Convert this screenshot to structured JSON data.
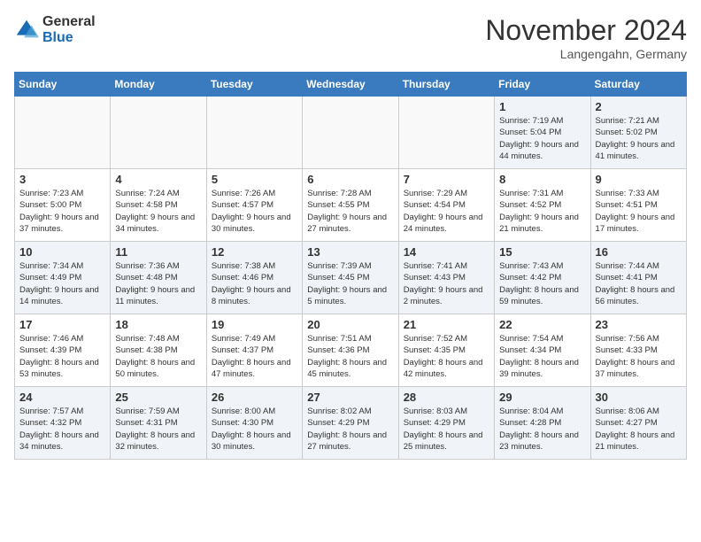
{
  "header": {
    "logo_general": "General",
    "logo_blue": "Blue",
    "month_title": "November 2024",
    "location": "Langengahn, Germany"
  },
  "weekdays": [
    "Sunday",
    "Monday",
    "Tuesday",
    "Wednesday",
    "Thursday",
    "Friday",
    "Saturday"
  ],
  "weeks": [
    [
      {
        "day": "",
        "info": ""
      },
      {
        "day": "",
        "info": ""
      },
      {
        "day": "",
        "info": ""
      },
      {
        "day": "",
        "info": ""
      },
      {
        "day": "",
        "info": ""
      },
      {
        "day": "1",
        "info": "Sunrise: 7:19 AM\nSunset: 5:04 PM\nDaylight: 9 hours\nand 44 minutes."
      },
      {
        "day": "2",
        "info": "Sunrise: 7:21 AM\nSunset: 5:02 PM\nDaylight: 9 hours\nand 41 minutes."
      }
    ],
    [
      {
        "day": "3",
        "info": "Sunrise: 7:23 AM\nSunset: 5:00 PM\nDaylight: 9 hours\nand 37 minutes."
      },
      {
        "day": "4",
        "info": "Sunrise: 7:24 AM\nSunset: 4:58 PM\nDaylight: 9 hours\nand 34 minutes."
      },
      {
        "day": "5",
        "info": "Sunrise: 7:26 AM\nSunset: 4:57 PM\nDaylight: 9 hours\nand 30 minutes."
      },
      {
        "day": "6",
        "info": "Sunrise: 7:28 AM\nSunset: 4:55 PM\nDaylight: 9 hours\nand 27 minutes."
      },
      {
        "day": "7",
        "info": "Sunrise: 7:29 AM\nSunset: 4:54 PM\nDaylight: 9 hours\nand 24 minutes."
      },
      {
        "day": "8",
        "info": "Sunrise: 7:31 AM\nSunset: 4:52 PM\nDaylight: 9 hours\nand 21 minutes."
      },
      {
        "day": "9",
        "info": "Sunrise: 7:33 AM\nSunset: 4:51 PM\nDaylight: 9 hours\nand 17 minutes."
      }
    ],
    [
      {
        "day": "10",
        "info": "Sunrise: 7:34 AM\nSunset: 4:49 PM\nDaylight: 9 hours\nand 14 minutes."
      },
      {
        "day": "11",
        "info": "Sunrise: 7:36 AM\nSunset: 4:48 PM\nDaylight: 9 hours\nand 11 minutes."
      },
      {
        "day": "12",
        "info": "Sunrise: 7:38 AM\nSunset: 4:46 PM\nDaylight: 9 hours\nand 8 minutes."
      },
      {
        "day": "13",
        "info": "Sunrise: 7:39 AM\nSunset: 4:45 PM\nDaylight: 9 hours\nand 5 minutes."
      },
      {
        "day": "14",
        "info": "Sunrise: 7:41 AM\nSunset: 4:43 PM\nDaylight: 9 hours\nand 2 minutes."
      },
      {
        "day": "15",
        "info": "Sunrise: 7:43 AM\nSunset: 4:42 PM\nDaylight: 8 hours\nand 59 minutes."
      },
      {
        "day": "16",
        "info": "Sunrise: 7:44 AM\nSunset: 4:41 PM\nDaylight: 8 hours\nand 56 minutes."
      }
    ],
    [
      {
        "day": "17",
        "info": "Sunrise: 7:46 AM\nSunset: 4:39 PM\nDaylight: 8 hours\nand 53 minutes."
      },
      {
        "day": "18",
        "info": "Sunrise: 7:48 AM\nSunset: 4:38 PM\nDaylight: 8 hours\nand 50 minutes."
      },
      {
        "day": "19",
        "info": "Sunrise: 7:49 AM\nSunset: 4:37 PM\nDaylight: 8 hours\nand 47 minutes."
      },
      {
        "day": "20",
        "info": "Sunrise: 7:51 AM\nSunset: 4:36 PM\nDaylight: 8 hours\nand 45 minutes."
      },
      {
        "day": "21",
        "info": "Sunrise: 7:52 AM\nSunset: 4:35 PM\nDaylight: 8 hours\nand 42 minutes."
      },
      {
        "day": "22",
        "info": "Sunrise: 7:54 AM\nSunset: 4:34 PM\nDaylight: 8 hours\nand 39 minutes."
      },
      {
        "day": "23",
        "info": "Sunrise: 7:56 AM\nSunset: 4:33 PM\nDaylight: 8 hours\nand 37 minutes."
      }
    ],
    [
      {
        "day": "24",
        "info": "Sunrise: 7:57 AM\nSunset: 4:32 PM\nDaylight: 8 hours\nand 34 minutes."
      },
      {
        "day": "25",
        "info": "Sunrise: 7:59 AM\nSunset: 4:31 PM\nDaylight: 8 hours\nand 32 minutes."
      },
      {
        "day": "26",
        "info": "Sunrise: 8:00 AM\nSunset: 4:30 PM\nDaylight: 8 hours\nand 30 minutes."
      },
      {
        "day": "27",
        "info": "Sunrise: 8:02 AM\nSunset: 4:29 PM\nDaylight: 8 hours\nand 27 minutes."
      },
      {
        "day": "28",
        "info": "Sunrise: 8:03 AM\nSunset: 4:29 PM\nDaylight: 8 hours\nand 25 minutes."
      },
      {
        "day": "29",
        "info": "Sunrise: 8:04 AM\nSunset: 4:28 PM\nDaylight: 8 hours\nand 23 minutes."
      },
      {
        "day": "30",
        "info": "Sunrise: 8:06 AM\nSunset: 4:27 PM\nDaylight: 8 hours\nand 21 minutes."
      }
    ]
  ]
}
